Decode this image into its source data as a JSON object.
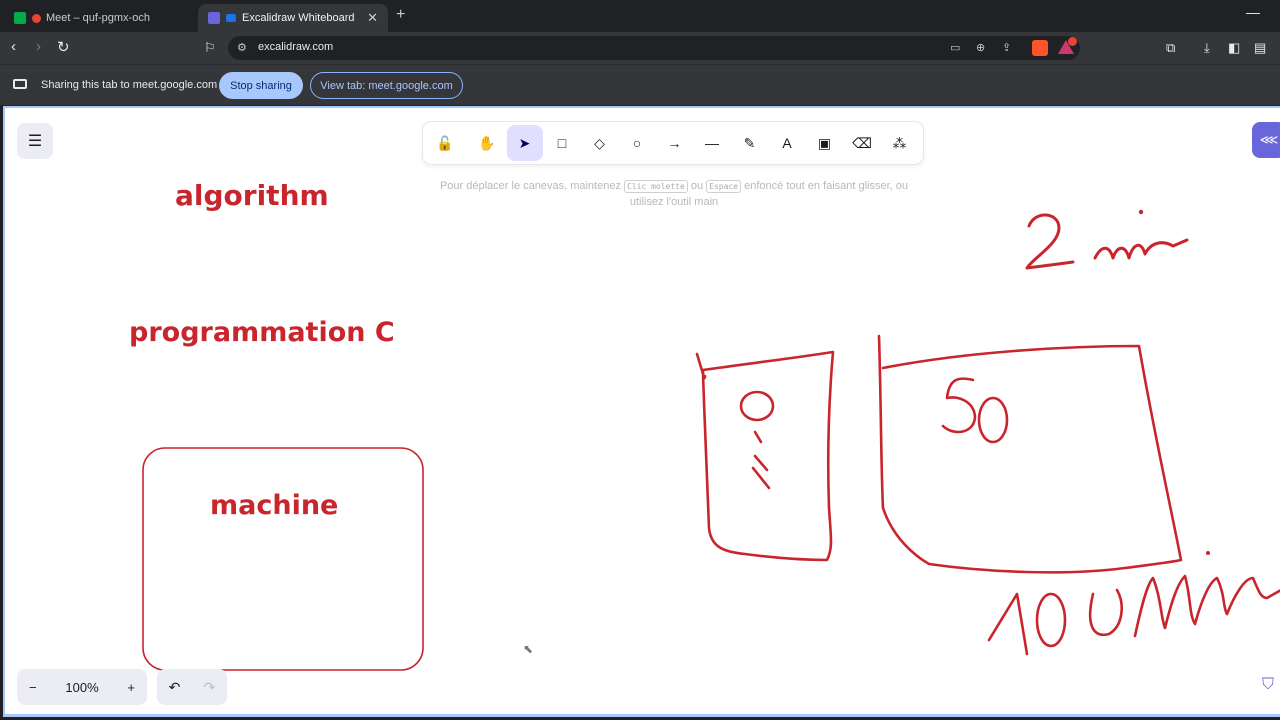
{
  "browser": {
    "tabs": [
      {
        "title": "Meet – quf-pgmx-och",
        "active": false
      },
      {
        "title": "Excalidraw Whiteboard",
        "active": true
      }
    ],
    "url": "excalidraw.com"
  },
  "sharing_bar": {
    "message": "Sharing this tab to meet.google.com",
    "stop_label": "Stop sharing",
    "view_label": "View tab: meet.google.com"
  },
  "excalidraw": {
    "tools": [
      {
        "name": "lock",
        "icon": "lock-icon",
        "glyph": "🔓"
      },
      {
        "name": "hand",
        "icon": "hand-icon",
        "glyph": "✋"
      },
      {
        "name": "selection",
        "icon": "pointer-icon",
        "glyph": "➤",
        "selected": true
      },
      {
        "name": "rectangle",
        "icon": "square-icon",
        "glyph": "□"
      },
      {
        "name": "diamond",
        "icon": "diamond-icon",
        "glyph": "◇"
      },
      {
        "name": "ellipse",
        "icon": "circle-icon",
        "glyph": "○"
      },
      {
        "name": "arrow",
        "icon": "arrow-icon",
        "glyph": "→"
      },
      {
        "name": "line",
        "icon": "line-icon",
        "glyph": "—"
      },
      {
        "name": "draw",
        "icon": "pencil-icon",
        "glyph": "✎"
      },
      {
        "name": "text",
        "icon": "text-icon",
        "glyph": "A"
      },
      {
        "name": "image",
        "icon": "image-icon",
        "glyph": "▣"
      },
      {
        "name": "eraser",
        "icon": "eraser-icon",
        "glyph": "⌫"
      },
      {
        "name": "extra-tools",
        "icon": "shapes-icon",
        "glyph": "⁂"
      }
    ],
    "hint": {
      "part1": "Pour déplacer le canevas, maintenez ",
      "key1": "Clic molette",
      "part2": " ou ",
      "key2": "Espace",
      "part3": " enfoncé tout en faisant glisser, ou utilisez l'outil main"
    },
    "zoom_level": "100%",
    "board": {
      "text1": "algorithm",
      "text2": "programmation C",
      "text3": "machine",
      "stroke_color": "#c9252d"
    }
  }
}
